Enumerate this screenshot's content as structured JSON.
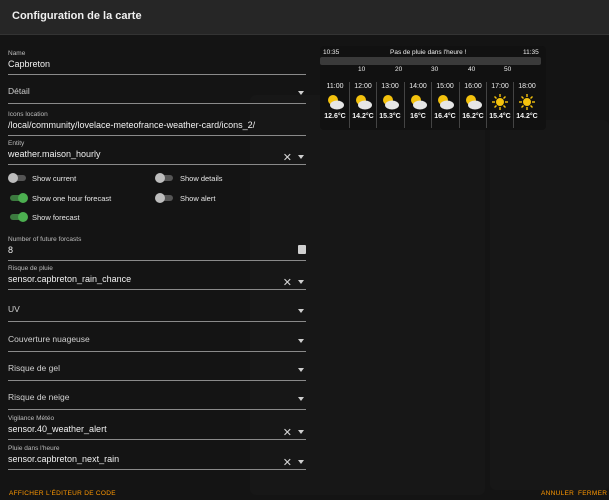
{
  "dialog": {
    "title": "Configuration de la carte"
  },
  "form": {
    "name": {
      "label": "Name",
      "value": "Capbreton"
    },
    "detail": {
      "placeholder": "Détail"
    },
    "icons_location": {
      "label": "Icons location",
      "value": "/local/community/lovelace-meteofrance-weather-card/icons_2/"
    },
    "entity": {
      "label": "Entity",
      "value": "weather.maison_hourly"
    },
    "toggles": [
      {
        "label": "Show current",
        "on": false
      },
      {
        "label": "Show details",
        "on": false
      },
      {
        "label": "Show one hour forecast",
        "on": true
      },
      {
        "label": "Show alert",
        "on": false
      },
      {
        "label": "Show forecast",
        "on": true
      }
    ],
    "future": {
      "label": "Number of future forcasts",
      "value": "8"
    },
    "rain_risk": {
      "label": "Risque de pluie",
      "value": "sensor.capbreton_rain_chance"
    },
    "uv": {
      "placeholder": "UV"
    },
    "cloud": {
      "placeholder": "Couverture nuageuse"
    },
    "frost": {
      "placeholder": "Risque de gel"
    },
    "snow": {
      "placeholder": "Risque de neige"
    },
    "vigilance": {
      "label": "Vigilance Météo",
      "value": "sensor.40_weather_alert"
    },
    "rain_hour": {
      "label": "Pluie dans l'heure",
      "value": "sensor.capbreton_next_rain"
    }
  },
  "footer": {
    "code_editor": "AFFICHER L'ÉDITEUR DE CODE",
    "cancel": "ANNULER",
    "close": "FERMER"
  },
  "preview": {
    "rain": {
      "start": "10:35",
      "message": "Pas de pluie dans l'heure !",
      "end": "11:35"
    },
    "minute_ticks": [
      "10",
      "20",
      "30",
      "40",
      "50"
    ],
    "forecast": [
      {
        "time": "11:00",
        "icon": "sun-cloud-icon",
        "temp": "12.6°C"
      },
      {
        "time": "12:00",
        "icon": "sun-cloud-icon",
        "temp": "14.2°C"
      },
      {
        "time": "13:00",
        "icon": "sun-cloud-icon",
        "temp": "15.3°C"
      },
      {
        "time": "14:00",
        "icon": "sun-cloud-icon",
        "temp": "16°C"
      },
      {
        "time": "15:00",
        "icon": "sun-cloud-icon",
        "temp": "16.4°C"
      },
      {
        "time": "16:00",
        "icon": "sun-cloud-icon",
        "temp": "16.2°C"
      },
      {
        "time": "17:00",
        "icon": "sun-icon",
        "temp": "15.4°C"
      },
      {
        "time": "18:00",
        "icon": "sun-icon",
        "temp": "14.2°C"
      }
    ]
  },
  "colors": {
    "accent": "#ff9800",
    "toggle_on": "#4caf50",
    "sun": "#f4c20d"
  }
}
